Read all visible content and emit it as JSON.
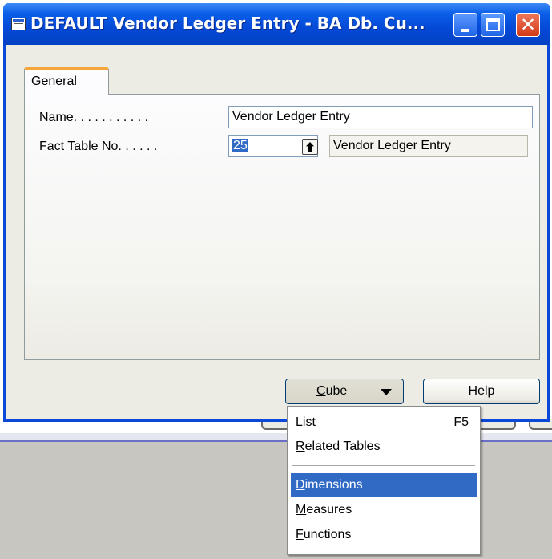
{
  "window": {
    "title": "DEFAULT Vendor Ledger Entry - BA Db. Cu...",
    "min_label": "",
    "max_label": "",
    "close_label": "✕"
  },
  "tabs": [
    {
      "label": "General"
    }
  ],
  "form": {
    "name_label": "Name. . . . . . . . . . .",
    "name_value": "Vendor Ledger Entry",
    "fact_label": "Fact Table No. . . . . .",
    "fact_no": "25",
    "fact_name": "Vendor Ledger Entry"
  },
  "buttons": {
    "cube_first": "C",
    "cube_rest": "ube",
    "help": "Help"
  },
  "menu": {
    "items": [
      {
        "mn": "L",
        "rest": "ist",
        "shortcut": "F5"
      },
      {
        "mn": "R",
        "rest": "elated Tables",
        "shortcut": ""
      },
      {
        "mn": "D",
        "rest": "imensions",
        "shortcut": ""
      },
      {
        "mn": "M",
        "rest": "easures",
        "shortcut": ""
      },
      {
        "mn": "F",
        "rest": "unctions",
        "shortcut": ""
      }
    ],
    "highlighted": "Dimensions"
  }
}
